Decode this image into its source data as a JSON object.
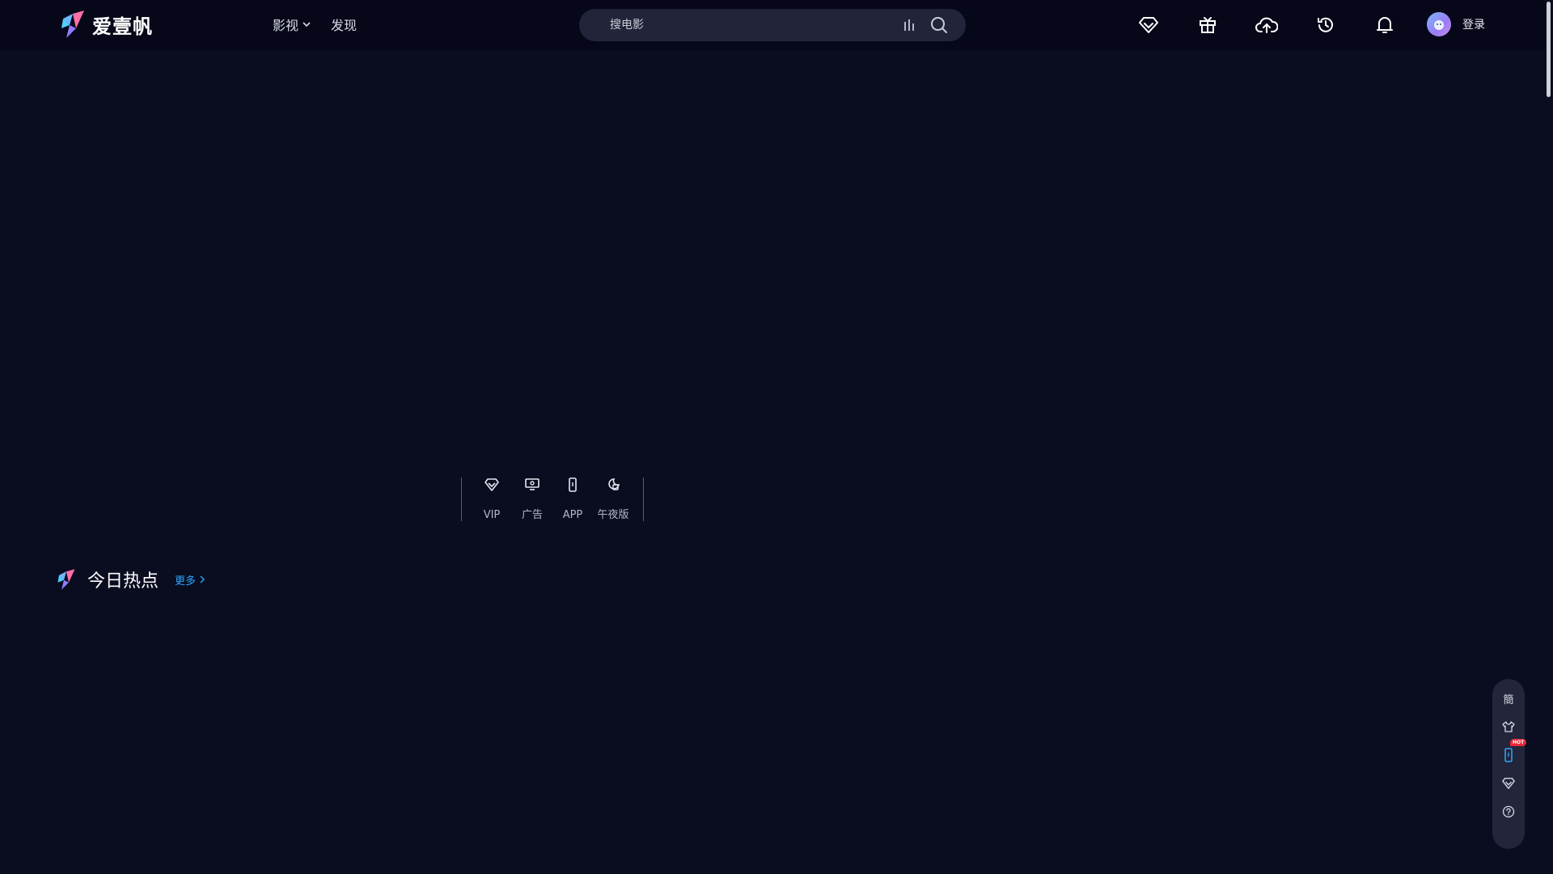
{
  "brand": {
    "name": "爱壹帆",
    "accent": "#2aa8ff"
  },
  "nav": {
    "video_label": "影视",
    "discover_label": "发现"
  },
  "search": {
    "placeholder": "搜电影"
  },
  "toolbar": {
    "icons": [
      "vip-icon",
      "gift-icon",
      "upload-icon",
      "history-icon",
      "bell-icon"
    ]
  },
  "user": {
    "login_label": "登录"
  },
  "features": {
    "items": [
      {
        "label": "VIP",
        "icon": "vip-diamond-icon"
      },
      {
        "label": "广告",
        "icon": "ad-screen-icon"
      },
      {
        "label": "APP",
        "icon": "phone-icon"
      },
      {
        "label": "午夜版",
        "icon": "midnight-icon"
      }
    ]
  },
  "hot": {
    "title": "今日热点",
    "more_label": "更多"
  },
  "side": {
    "lang_label": "簡",
    "hot_badge": "HOT"
  }
}
